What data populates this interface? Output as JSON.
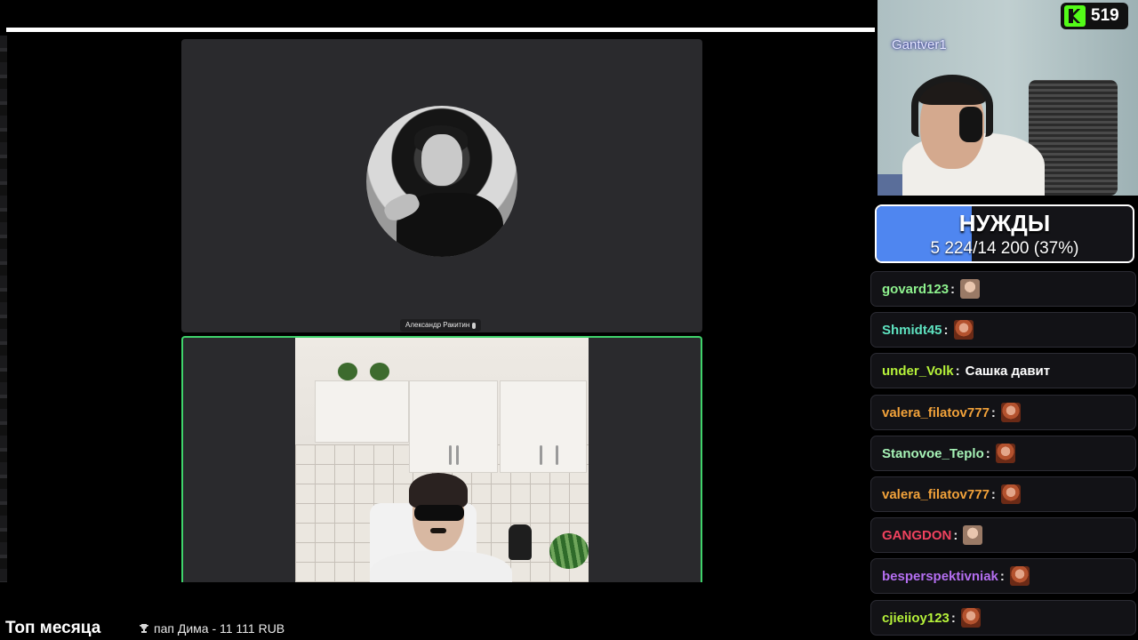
{
  "call": {
    "participant_top_name": "Александр Ракитин"
  },
  "bottom": {
    "top_month_label": "Топ месяца",
    "donor_text": "пап Дима - 11 111 RUB"
  },
  "stream": {
    "channel_name": "Gantver1",
    "viewer_count": "519",
    "platform_icon": "kick-logo-icon"
  },
  "goal": {
    "title": "НУЖДЫ",
    "progress_text": "5 224/14 200 (37%)",
    "progress_fraction": 0.37,
    "fill_color": "#4f86f0"
  },
  "chat": {
    "messages": [
      {
        "user": "govard123",
        "color": "#8ef28e",
        "text": "",
        "emote": "light"
      },
      {
        "user": "Shmidt45",
        "color": "#5ee3c0",
        "text": "",
        "emote": "red"
      },
      {
        "user": "under_Volk",
        "color": "#b6f23a",
        "text": "Сашка давит",
        "emote": ""
      },
      {
        "user": "valera_filatov777",
        "color": "#f2a23a",
        "text": "",
        "emote": "red"
      },
      {
        "user": "Stanovoe_Teplo",
        "color": "#a6f2b6",
        "text": "",
        "emote": "red"
      },
      {
        "user": "valera_filatov777",
        "color": "#f2a23a",
        "text": "",
        "emote": "red"
      },
      {
        "user": "GANGDON",
        "color": "#f0425e",
        "text": "",
        "emote": "light"
      },
      {
        "user": "besperspektivniak",
        "color": "#b46ef0",
        "text": "",
        "emote": "red"
      },
      {
        "user": "cjieiioy123",
        "color": "#b6f23a",
        "text": "",
        "emote": "red"
      }
    ]
  }
}
